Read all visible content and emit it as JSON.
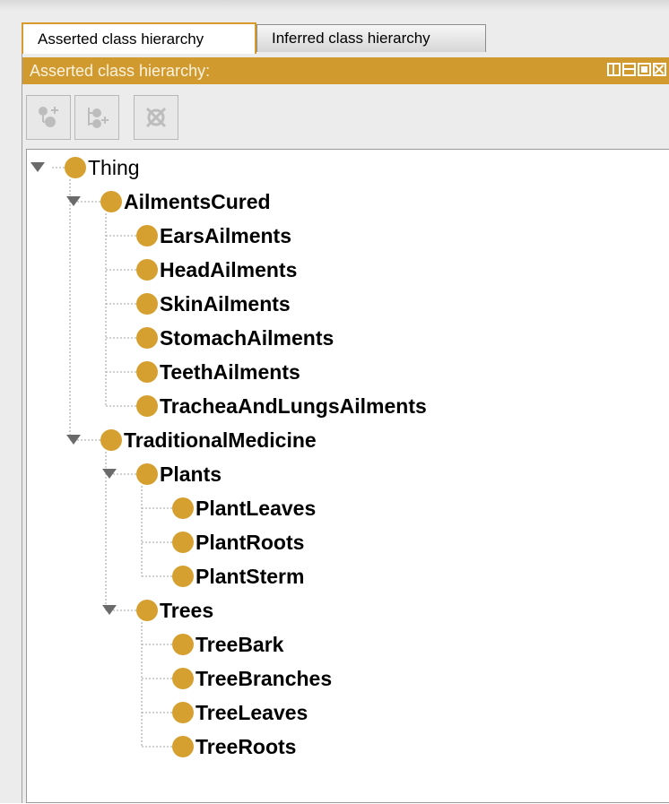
{
  "tabs": [
    {
      "label": "Asserted class hierarchy",
      "active": true
    },
    {
      "label": "Inferred class hierarchy",
      "active": false
    }
  ],
  "panel": {
    "title": "Asserted class hierarchy:",
    "accent_color": "#d19a2e",
    "window_controls": [
      "split-vertical-icon",
      "split-horizontal-icon",
      "maximize-icon",
      "close-icon"
    ]
  },
  "toolbar": {
    "buttons": [
      {
        "name": "add-subclass-button",
        "icon": "add-subclass-icon"
      },
      {
        "name": "add-sibling-button",
        "icon": "add-sibling-icon"
      },
      {
        "name": "delete-class-button",
        "icon": "delete-class-icon"
      }
    ]
  },
  "tree": {
    "root": "Thing",
    "node_color": "#d6a030",
    "nodes": [
      {
        "label": "AilmentsCured",
        "expanded": true
      },
      {
        "label": "EarsAilments"
      },
      {
        "label": "HeadAilments"
      },
      {
        "label": "SkinAilments"
      },
      {
        "label": "StomachAilments"
      },
      {
        "label": "TeethAilments"
      },
      {
        "label": "TracheaAndLungsAilments"
      },
      {
        "label": "TraditionalMedicine",
        "expanded": true
      },
      {
        "label": "Plants",
        "expanded": true
      },
      {
        "label": "PlantLeaves"
      },
      {
        "label": "PlantRoots"
      },
      {
        "label": "PlantSterm"
      },
      {
        "label": "Trees",
        "expanded": true
      },
      {
        "label": "TreeBark"
      },
      {
        "label": "TreeBranches"
      },
      {
        "label": "TreeLeaves"
      },
      {
        "label": "TreeRoots"
      }
    ]
  }
}
